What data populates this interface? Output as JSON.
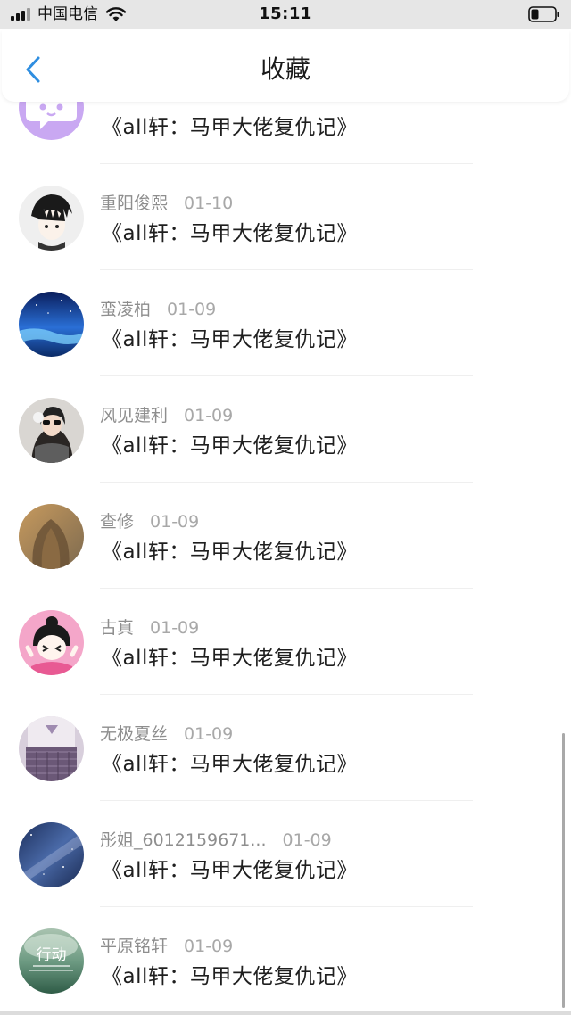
{
  "status_bar": {
    "carrier": "中国电信",
    "time": "15:11"
  },
  "header": {
    "title": "收藏"
  },
  "items": [
    {
      "username": "",
      "date": "",
      "book": "《all轩：马甲大佬复仇记》",
      "avatar_icon": "chat-bubble-avatar",
      "avatar_color": "#c9a8f2"
    },
    {
      "username": "重阳俊熙",
      "date": "01-10",
      "book": "《all轩：马甲大佬复仇记》",
      "avatar_icon": "anime-boy-avatar",
      "avatar_color": "#efefef"
    },
    {
      "username": "蛮凌柏",
      "date": "01-09",
      "book": "《all轩：马甲大佬复仇记》",
      "avatar_icon": "night-sky-avatar",
      "avatar_color": "#1e5bbf"
    },
    {
      "username": "风见建利",
      "date": "01-09",
      "book": "《all轩：马甲大佬复仇记》",
      "avatar_icon": "girl-photo-avatar",
      "avatar_color": "#6f6a66"
    },
    {
      "username": "查修",
      "date": "01-09",
      "book": "《all轩：马甲大佬复仇记》",
      "avatar_icon": "hair-photo-avatar",
      "avatar_color": "#a88862"
    },
    {
      "username": "古真",
      "date": "01-09",
      "book": "《all轩：马甲大佬复仇记》",
      "avatar_icon": "cartoon-girl-avatar",
      "avatar_color": "#f4a6c9"
    },
    {
      "username": "无极夏丝",
      "date": "01-09",
      "book": "《all轩：马甲大佬复仇记》",
      "avatar_icon": "uniform-photo-avatar",
      "avatar_color": "#b39ab8"
    },
    {
      "username": "彤姐_6012159671...",
      "date": "01-09",
      "book": "《all轩：马甲大佬复仇记》",
      "avatar_icon": "galaxy-avatar",
      "avatar_color": "#2e4a7a"
    },
    {
      "username": "平原铭轩",
      "date": "01-09",
      "book": "《all轩：马甲大佬复仇记》",
      "avatar_icon": "action-text-avatar",
      "avatar_color": "#7fa38a",
      "avatar_text": "行动"
    }
  ],
  "colors": {
    "accent": "#2f8ee0",
    "title_text": "#1f1f1f",
    "meta_text": "#8e8e8e"
  }
}
